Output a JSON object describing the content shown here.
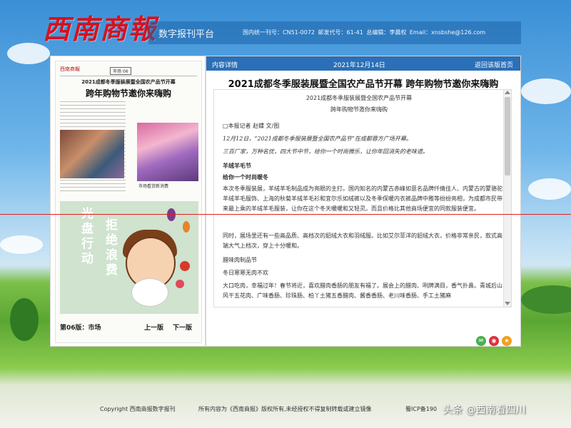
{
  "header": {
    "logo": "西南商報",
    "platform": "数字报刊平台",
    "meta": "国内统一刊号：CN51-0072    邮发代号：61-41    总编辑：李晨权    Email：xnsbshe@126.com"
  },
  "paper": {
    "masthead": "西南商報",
    "section": "市场 06",
    "subhead": "2021成都冬季服装展暨全国农产品节开幕",
    "headline": "跨年购物节邀你来嗨购",
    "caption": "市场看货新消费",
    "ad_text_1": "光盘行动",
    "ad_text_2": "拒绝浪费",
    "page_label": "第06版：市场",
    "prev_label": "上一版",
    "next_label": "下一版"
  },
  "article_panel": {
    "tab": "内容详情",
    "date": "2021年12月14日",
    "back": "返回该版首页",
    "title": "2021成都冬季服装展暨全国农产品节开幕 跨年购物节邀你来嗨购",
    "lines": {
      "sub1": "2021成都冬季服装展暨全国农产品节开幕",
      "sub2": "跨年购物节邀你来嗨购",
      "byline": "□本报记者 赵蝶 文/图",
      "p1": "12月12日，“2021成都冬季服装展暨全国农产品节”在成都蓉方广场开幕。",
      "p2": "三百厂家，万种名优，四大节中节，给你一个时尚微乐，让你年回消失的老味道。",
      "h1": "羊绒羊毛节",
      "h2": "给你一个时尚暖冬",
      "p3": "本次冬季服装展，羊绒羊毛制品成为亮眼的主打。国内知名的内蒙古赤峰如意名品牌仟倩佳人、内蒙古的蒙骆驼羊绒羊毛服饰、上海的秋菊羊绒羊毛衫和宜尔乐如绒裤以及冬季保暖内衣裤品牌中雅等纷纷亮相，为成都市民带来最上乘的羊绒羊毛服装，让你在这个冬天暖暖和又轻灵。而且价格比其他商场便宜的同款服装便宜。",
      "p4": "同时，展场里还有一些高品质、高档次的貂绒大衣和羽绒服。比如艾尔菲洋的貂绒大衣，价格非常亲民，款式高端大气上档次，穿上十分暖和。",
      "h3": "腊味肉制品节",
      "h4": "冬日寒寒无肉不欢",
      "p5": "大口吃肉，幸福过年！春节将近，喜欢腊肉香肠的朋友有福了。展会上的腊肉、咧牌满目，香气扑鼻。青城后山风干五花肉、广味香肠、珍珠肠、柏丫土猪五香腊肉、酱香香肠、老川味香肠、手工土猪麻"
    }
  },
  "share_icons": [
    "wechat-icon",
    "weibo-icon",
    "star-icon"
  ],
  "footer": {
    "copyright": "Copyright 西南商报数字报刊",
    "rights": "所有内容为《西南商报》版权所有,未经授权不得复制转载或建立镜像",
    "icp": "蜀ICP备190",
    "watermark": "头条 @西南看四川"
  },
  "colors": {
    "header_blue": "#2a6fb8",
    "logo_red": "#d8101c",
    "guide_line": "#e02020"
  }
}
